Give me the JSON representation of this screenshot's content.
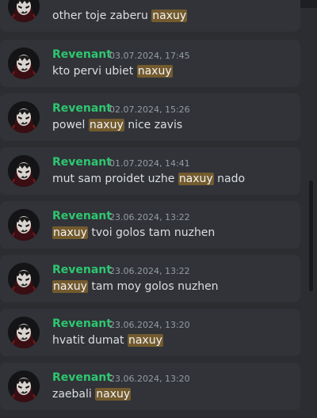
{
  "results": [
    {
      "author": "",
      "timestamp": "",
      "text_before": "other toje zaberu ",
      "highlight": "naxuy",
      "text_after": ""
    },
    {
      "author": "Revenant",
      "timestamp": "03.07.2024, 17:45",
      "text_before": "kto pervi ubiet ",
      "highlight": "naxuy",
      "text_after": ""
    },
    {
      "author": "Revenant",
      "timestamp": "02.07.2024, 15:26",
      "text_before": "powel ",
      "highlight": "naxuy",
      "text_after": " nice zavis"
    },
    {
      "author": "Revenant",
      "timestamp": "01.07.2024, 14:41",
      "text_before": "mut sam proidet uzhe ",
      "highlight": "naxuy",
      "text_after": " nado"
    },
    {
      "author": "Revenant",
      "timestamp": "23.06.2024, 13:22",
      "text_before": "",
      "highlight": "naxuy",
      "text_after": " tvoi golos tam nuzhen"
    },
    {
      "author": "Revenant",
      "timestamp": "23.06.2024, 13:22",
      "text_before": "",
      "highlight": "naxuy",
      "text_after": " tam moy golos nuzhen"
    },
    {
      "author": "Revenant",
      "timestamp": "23.06.2024, 13:20",
      "text_before": "hvatit dumat ",
      "highlight": "naxuy",
      "text_after": ""
    },
    {
      "author": "Revenant",
      "timestamp": "23.06.2024, 13:20",
      "text_before": "zaebali ",
      "highlight": "naxuy",
      "text_after": ""
    }
  ],
  "colors": {
    "author": "#2dc770",
    "highlight": "#735b2e",
    "card": "#313338",
    "background": "#2b2d31"
  },
  "icons": {
    "avatar": "avatar-image"
  }
}
